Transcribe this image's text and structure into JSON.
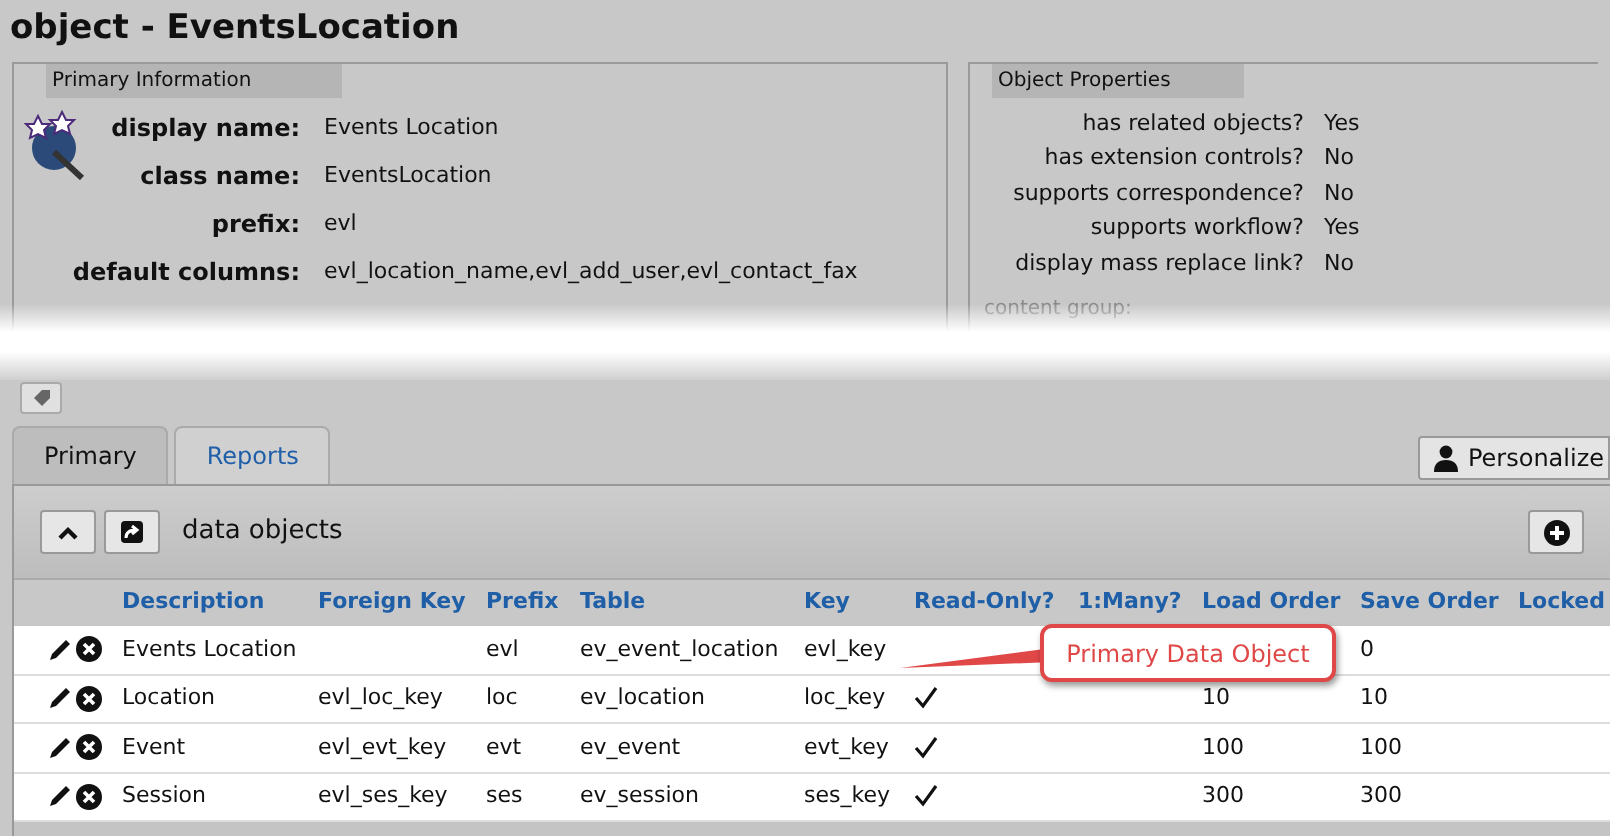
{
  "title": "object - EventsLocation",
  "primary_information": {
    "heading": "Primary Information",
    "fields": [
      {
        "label": "display name:",
        "value": "Events Location"
      },
      {
        "label": "class name:",
        "value": "EventsLocation"
      },
      {
        "label": "prefix:",
        "value": "evl"
      },
      {
        "label": "default columns:",
        "value": "evl_location_name,evl_add_user,evl_contact_fax"
      }
    ]
  },
  "object_properties": {
    "heading": "Object Properties",
    "fields": [
      {
        "label": "has related objects?",
        "value": "Yes"
      },
      {
        "label": "has extension controls?",
        "value": "No"
      },
      {
        "label": "supports correspondence?",
        "value": "No"
      },
      {
        "label": "supports workflow?",
        "value": "Yes"
      },
      {
        "label": "display mass replace link?",
        "value": "No"
      }
    ],
    "content_group_label": "content group:"
  },
  "tabs": [
    {
      "label": "Primary",
      "selected": true
    },
    {
      "label": "Reports",
      "selected": false
    }
  ],
  "personalize_button": "Personalize",
  "section_title": "data objects",
  "table": {
    "columns": [
      "Description",
      "Foreign Key",
      "Prefix",
      "Table",
      "Key",
      "Read-Only?",
      "1:Many?",
      "Load Order",
      "Save Order",
      "Locked"
    ],
    "rows": [
      {
        "description": "Events Location",
        "foreign_key": "",
        "prefix": "evl",
        "table": "ev_event_location",
        "key": "evl_key",
        "read_only": false,
        "save_order": "0"
      },
      {
        "description": "Location",
        "foreign_key": "evl_loc_key",
        "prefix": "loc",
        "table": "ev_location",
        "key": "loc_key",
        "read_only": true,
        "load_order": "10",
        "save_order": "10"
      },
      {
        "description": "Event",
        "foreign_key": "evl_evt_key",
        "prefix": "evt",
        "table": "ev_event",
        "key": "evt_key",
        "read_only": true,
        "load_order": "100",
        "save_order": "100"
      },
      {
        "description": "Session",
        "foreign_key": "evl_ses_key",
        "prefix": "ses",
        "table": "ev_session",
        "key": "ses_key",
        "read_only": true,
        "load_order": "300",
        "save_order": "300"
      }
    ]
  },
  "callout": {
    "text": "Primary Data Object"
  }
}
